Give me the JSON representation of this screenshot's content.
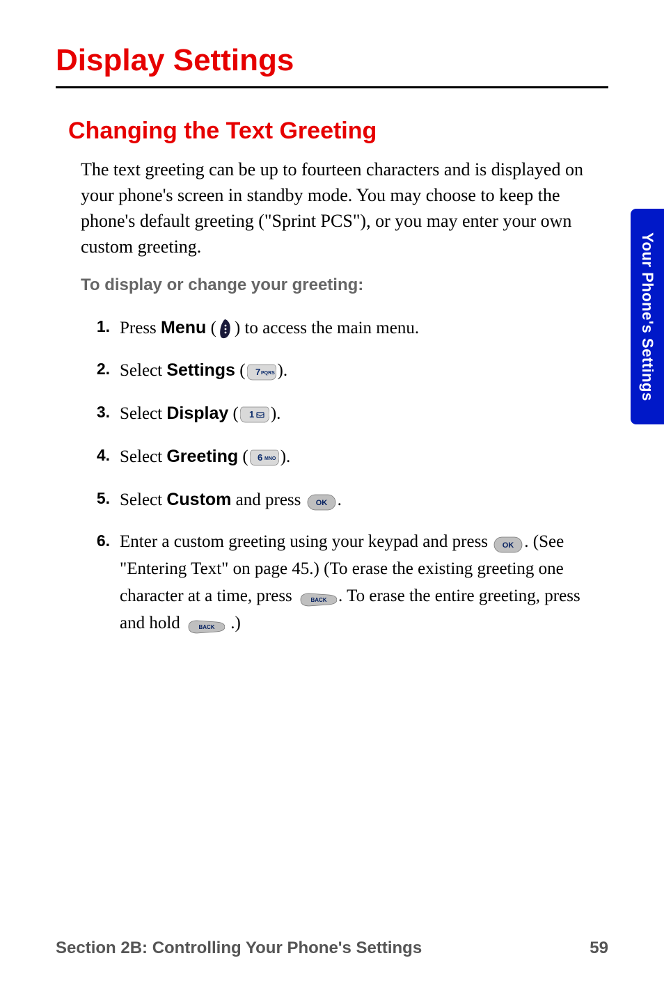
{
  "h1": "Display Settings",
  "h2": "Changing the Text Greeting",
  "intro": "The text greeting can be up to fourteen characters and is displayed on your phone's screen in standby mode. You may choose to keep the phone's default greeting (\"Sprint PCS\"), or you may enter your own custom greeting.",
  "sub": "To display or change your greeting:",
  "steps": {
    "s1": {
      "num": "1.",
      "a": "Press ",
      "b": "Menu",
      "c": " (",
      "d": ") to access the main menu."
    },
    "s2": {
      "num": "2.",
      "a": "Select ",
      "b": "Settings",
      "c": " (",
      "d": ")."
    },
    "s3": {
      "num": "3.",
      "a": "Select ",
      "b": "Display",
      "c": " (",
      "d": ")."
    },
    "s4": {
      "num": "4.",
      "a": "Select ",
      "b": "Greeting",
      "c": " (",
      "d": ")."
    },
    "s5": {
      "num": "5.",
      "a": "Select ",
      "b": "Custom",
      "c": " and press ",
      "d": "."
    },
    "s6": {
      "num": "6.",
      "a": "Enter a custom greeting using your keypad and press ",
      "b": ". (See \"Entering Text\" on page 45.) (To erase the existing greeting one character at a time, press ",
      "c": ". To erase the entire greeting, press and hold ",
      "d": " .)"
    }
  },
  "sideTab": "Your Phone's Settings",
  "footer": {
    "section": "Section 2B: Controlling Your Phone's Settings",
    "page": "59"
  }
}
